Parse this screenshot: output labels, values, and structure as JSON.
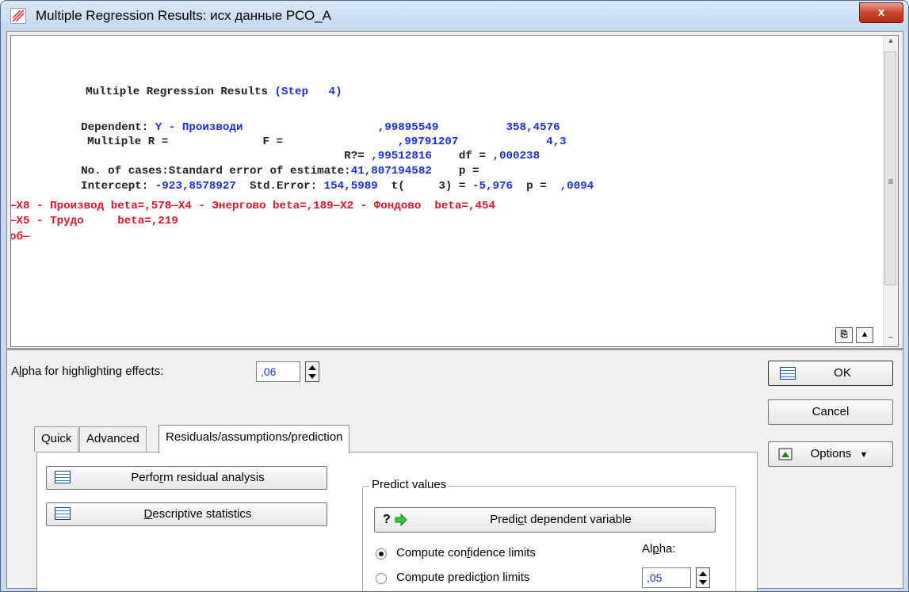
{
  "window": {
    "title": "Multiple Regression Results: исх данные РСО_А",
    "close_label": "x"
  },
  "output": {
    "lines": [
      [
        {
          "t": "Multiple Regression Results ",
          "c": "k"
        },
        {
          "t": "(Step   4)",
          "c": "v"
        }
      ],
      [
        {
          "t": "Dependent: ",
          "c": "k"
        },
        {
          "t": "Y - Производи                    ,99895549          358,4576",
          "c": "v"
        }
      ],
      [
        {
          "t": "Multiple R =              F =                 ",
          "c": "k"
        },
        {
          "t": ",99791207             4,3",
          "c": "v"
        }
      ],
      [
        {
          "t": "                                       R?= ",
          "c": "k"
        },
        {
          "t": ",99512816",
          "c": "v"
        },
        {
          "t": "    df = ",
          "c": "k"
        },
        {
          "t": ",000238",
          "c": "v"
        }
      ],
      [
        {
          "t": "No. of cases:Standard error of estimate:",
          "c": "k"
        },
        {
          "t": "41,807194582",
          "c": "v"
        },
        {
          "t": "    p =",
          "c": "k"
        }
      ],
      [
        {
          "t": "Intercept: ",
          "c": "k"
        },
        {
          "t": "-923,8578927",
          "c": "v"
        },
        {
          "t": "  Std.Error: ",
          "c": "k"
        },
        {
          "t": "154,5989",
          "c": "v"
        },
        {
          "t": "  t(     3) = ",
          "c": "k"
        },
        {
          "t": "-5,976",
          "c": "v"
        },
        {
          "t": "  p =  ",
          "c": "k"
        },
        {
          "t": ",0094",
          "c": "v"
        }
      ],
      [
        {
          "t": "—X8 - Производ beta=,578—X4 - Энергово beta=,189—X2 - Фондово  beta=,454",
          "c": "r"
        }
      ],
      [
        {
          "t": "—X5 - Трудо     beta=,219",
          "c": "r"
        }
      ],
      [
        {
          "t": "об—",
          "c": "r"
        }
      ]
    ]
  },
  "alpha_highlight": {
    "label_pre": "A",
    "label_ul": "l",
    "label_post": "pha for highlighting effects:",
    "value": ",06"
  },
  "tabs": [
    {
      "label": "Quick",
      "active": false
    },
    {
      "label": "Advanced",
      "active": false
    },
    {
      "label": "Residuals/assumptions/prediction",
      "active": true
    }
  ],
  "panel": {
    "residual_pre": "Perfo",
    "residual_ul": "r",
    "residual_post": "m residual analysis",
    "descriptive_pre": "",
    "descriptive_ul": "D",
    "descriptive_post": "escriptive statistics",
    "predict_group_title": "Predict values",
    "predict_button_icon": "?",
    "predict_pre": "Predi",
    "predict_ul": "c",
    "predict_post": "t dependent variable",
    "confidence_pre": "Compute con",
    "confidence_ul": "f",
    "confidence_post": "idence limits",
    "prediction_pre": "Compute predic",
    "prediction_ul": "t",
    "prediction_post": "ion limits",
    "alpha_pre": "Al",
    "alpha_ul": "p",
    "alpha_post": "ha:",
    "alpha_value": ",05",
    "selected_limit": "confidence"
  },
  "side": {
    "ok_label": "OK",
    "cancel_label": "Cancel",
    "options_label": "Options"
  },
  "colors": {
    "keyword": "#202020",
    "value_blue": "#1b2fd6",
    "highlight_red": "#e0142a",
    "title_bar": "#c9dbef"
  }
}
